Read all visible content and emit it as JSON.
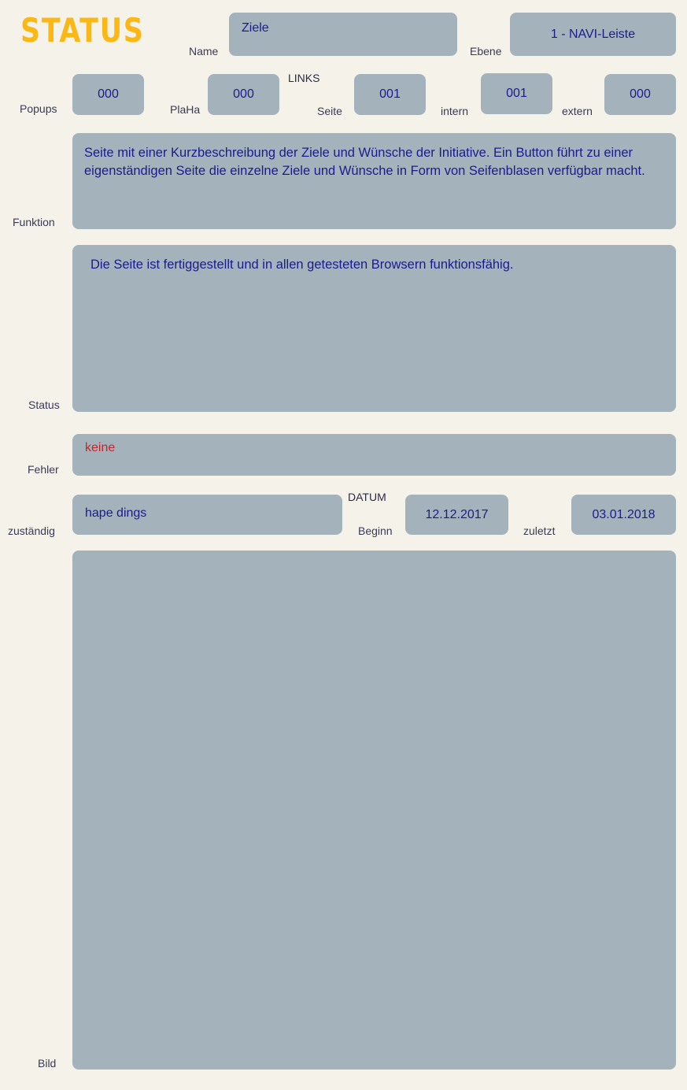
{
  "app": {
    "title": "STATUS"
  },
  "header": {
    "name_label": "Name",
    "name_value": "Ziele",
    "ebene_label": "Ebene",
    "ebene_value": "1 - NAVI-Leiste"
  },
  "counters": {
    "popups_label": "Popups",
    "popups_value": "000",
    "plaha_label": "PlaHa",
    "plaha_value": "000",
    "links_group_label": "LINKS",
    "seite_label": "Seite",
    "seite_value": "001",
    "intern_label": "intern",
    "intern_value": "001",
    "extern_label": "extern",
    "extern_value": "000"
  },
  "funktion": {
    "label": "Funktion",
    "text": "Seite mit einer Kurzbeschreibung der Ziele und Wünsche der Initiative. Ein Button führt zu einer eigenständigen Seite die einzelne Ziele und Wünsche in Form von Seifenblasen verfügbar macht."
  },
  "status": {
    "label": "Status",
    "text": "Die Seite ist fertiggestellt und in allen getesteten Browsern funktionsfähig."
  },
  "fehler": {
    "label": "Fehler",
    "text": "keine"
  },
  "zustaendig": {
    "label": "zuständig",
    "value": "hape dings"
  },
  "datum": {
    "group_label": "DATUM",
    "beginn_label": "Beginn",
    "beginn_value": "12.12.2017",
    "zuletzt_label": "zuletzt",
    "zuletzt_value": "03.01.2018"
  },
  "bild": {
    "label": "Bild",
    "value": ""
  },
  "colors": {
    "page_background": "#f5f2ea",
    "field_fill": "#a4b3bb",
    "title_accent": "#fbb713",
    "value_text": "#1b1b8f",
    "label_text": "#3a3a55",
    "status_ok": "#1a8a1a",
    "error_text": "#c0272d"
  }
}
